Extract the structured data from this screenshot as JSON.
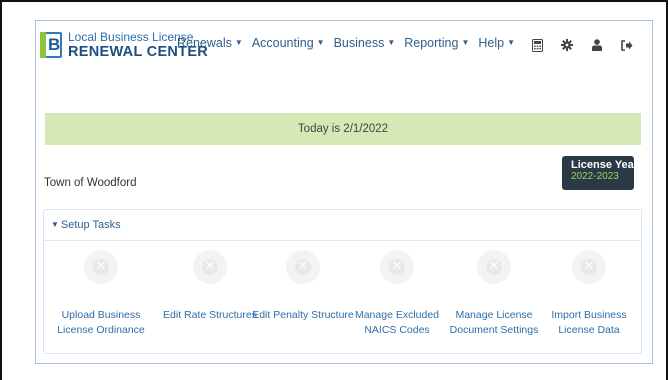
{
  "logo": {
    "mark": "B",
    "line1": "Local Business License",
    "line2": "RENEWAL CENTER"
  },
  "menu": [
    {
      "label": "Renewals"
    },
    {
      "label": "Accounting"
    },
    {
      "label": "Business"
    },
    {
      "label": "Reporting"
    },
    {
      "label": "Help"
    }
  ],
  "toolbar_icons": [
    "calculator-icon",
    "gear-icon",
    "user-icon",
    "sign-out-icon"
  ],
  "banner": {
    "text": "Today is 2/1/2022"
  },
  "town": "Town of Woodford",
  "license_year": {
    "title": "License Year",
    "value": "2022-2023"
  },
  "setup": {
    "heading": "Setup Tasks",
    "tasks": [
      {
        "label": "Upload Business License Ordinance"
      },
      {
        "label": "Edit Rate Structures"
      },
      {
        "label": "Edit Penalty Structure"
      },
      {
        "label": "Manage Excluded NAICS Codes"
      },
      {
        "label": "Manage License Document Settings"
      },
      {
        "label": "Import Business License Data"
      }
    ]
  },
  "colors": {
    "brand_blue": "#2f5f8c",
    "banner_green": "#d6e8b6",
    "license_bg": "#2b3947",
    "license_accent": "#9bd35a"
  }
}
